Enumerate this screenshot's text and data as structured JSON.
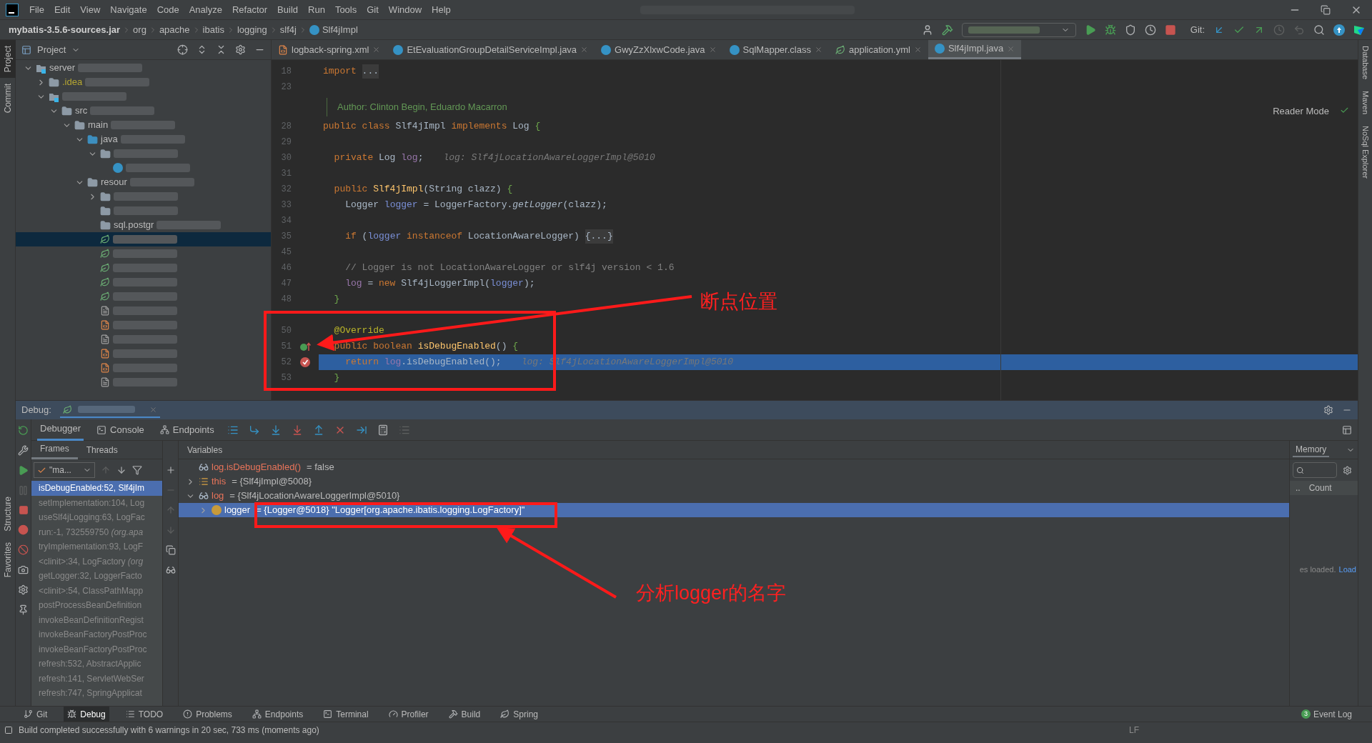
{
  "menu": [
    "File",
    "Edit",
    "View",
    "Navigate",
    "Code",
    "Analyze",
    "Refactor",
    "Build",
    "Run",
    "Tools",
    "Git",
    "Window",
    "Help"
  ],
  "breadcrumbs": [
    {
      "label": "mybatis-3.5.6-sources.jar",
      "kind": "root"
    },
    {
      "label": "org",
      "kind": "package"
    },
    {
      "label": "apache",
      "kind": "package"
    },
    {
      "label": "ibatis",
      "kind": "package"
    },
    {
      "label": "logging",
      "kind": "package"
    },
    {
      "label": "slf4j",
      "kind": "package"
    },
    {
      "label": "Slf4jImpl",
      "kind": "class"
    }
  ],
  "toolbar": {
    "git_label": "Git:"
  },
  "left_stripe": [
    {
      "label": "Project",
      "selected": true
    },
    {
      "label": "Commit",
      "selected": false
    },
    {
      "label": "Structure",
      "selected": false
    },
    {
      "label": "Favorites",
      "selected": false
    }
  ],
  "right_stripe": [
    {
      "label": "Database"
    },
    {
      "label": "Maven"
    },
    {
      "label": "NoSql Explorer"
    }
  ],
  "project": {
    "title": "Project",
    "tree": [
      {
        "label": "server",
        "kind": "module",
        "expanded": true,
        "selected": false,
        "children": [
          {
            "label": ".idea",
            "kind": "folder",
            "expanded": false,
            "selected": false
          },
          {
            "kind": "module",
            "expanded": true,
            "selected": false,
            "children": [
              {
                "label": "src",
                "kind": "folder",
                "expanded": true,
                "selected": false,
                "children": [
                  {
                    "label": "main",
                    "kind": "folder",
                    "expanded": true,
                    "selected": false,
                    "children": [
                      {
                        "label": "java",
                        "kind": "source",
                        "expanded": true,
                        "selected": false,
                        "children": [
                          {
                            "kind": "package",
                            "expanded": true,
                            "selected": false,
                            "children": [
                              {
                                "kind": "class",
                                "selected": false
                              }
                            ]
                          }
                        ]
                      },
                      {
                        "label": "resour",
                        "kind": "resources",
                        "expanded": true,
                        "selected": false,
                        "children": [
                          {
                            "kind": "folder",
                            "expanded": false,
                            "selected": false
                          },
                          {
                            "kind": "folder",
                            "selected": false
                          },
                          {
                            "label": "sql.postgr",
                            "kind": "folder",
                            "selected": false
                          },
                          {
                            "kind": "spring",
                            "selected": true
                          },
                          {
                            "kind": "spring",
                            "selected": false
                          },
                          {
                            "kind": "spring",
                            "selected": false
                          },
                          {
                            "kind": "spring",
                            "selected": false
                          },
                          {
                            "kind": "spring",
                            "selected": false
                          },
                          {
                            "kind": "text",
                            "selected": false
                          },
                          {
                            "kind": "xml",
                            "selected": false
                          },
                          {
                            "kind": "text",
                            "selected": false
                          },
                          {
                            "kind": "xml",
                            "selected": false
                          },
                          {
                            "kind": "xml",
                            "selected": false
                          },
                          {
                            "kind": "text",
                            "selected": false
                          }
                        ]
                      }
                    ]
                  }
                ]
              }
            ]
          }
        ]
      }
    ]
  },
  "editor": {
    "tabs": [
      {
        "label": "logback-spring.xml",
        "kind": "xml",
        "selected": false
      },
      {
        "label": "EtEvaluationGroupDetailServiceImpl.java",
        "kind": "class",
        "selected": false
      },
      {
        "label": "GwyZzXlxwCode.java",
        "kind": "class",
        "selected": false
      },
      {
        "label": "SqlMapper.class",
        "kind": "class",
        "selected": false
      },
      {
        "label": "application.yml",
        "kind": "spring",
        "selected": false
      },
      {
        "label": "Slf4jImpl.java",
        "kind": "class",
        "selected": true
      }
    ],
    "reader_mode": "Reader Mode",
    "lines": [
      {
        "number": "18",
        "current": false,
        "tokens": [
          {
            "kind": "keyword",
            "text": "import "
          },
          {
            "kind": "fold",
            "text": "..."
          }
        ]
      },
      {
        "number": "23",
        "current": false
      },
      {
        "kind": "doc",
        "text": "Author: Clinton Begin, Eduardo Macarron",
        "current": false
      },
      {
        "number": "28",
        "current": false,
        "tokens": [
          {
            "kind": "keyword",
            "text": "public class "
          },
          {
            "kind": "plain",
            "text": "Slf4jImpl "
          },
          {
            "kind": "keyword",
            "text": "implements "
          },
          {
            "kind": "plain",
            "text": "Log "
          },
          {
            "kind": "brace",
            "text": "{"
          }
        ]
      },
      {
        "number": "29",
        "current": false
      },
      {
        "number": "30",
        "current": false,
        "tokens": [
          {
            "kind": "keyword",
            "text": "  private "
          },
          {
            "kind": "plain",
            "text": "Log "
          },
          {
            "kind": "field",
            "text": "log"
          },
          {
            "kind": "plain",
            "text": ";"
          },
          {
            "kind": "hint",
            "text": "log: Slf4jLocationAwareLoggerImpl@5010"
          }
        ]
      },
      {
        "number": "31",
        "current": false
      },
      {
        "number": "32",
        "current": false,
        "tokens": [
          {
            "kind": "keyword",
            "text": "  public "
          },
          {
            "kind": "method",
            "text": "Slf4jImpl"
          },
          {
            "kind": "plain",
            "text": "(String clazz) "
          },
          {
            "kind": "brace",
            "text": "{"
          }
        ]
      },
      {
        "number": "33",
        "current": false,
        "tokens": [
          {
            "kind": "plain",
            "text": "    Logger "
          },
          {
            "kind": "var",
            "text": "logger"
          },
          {
            "kind": "plain",
            "text": " = LoggerFactory."
          },
          {
            "kind": "static",
            "text": "getLogger"
          },
          {
            "kind": "plain",
            "text": "(clazz);"
          }
        ]
      },
      {
        "number": "34",
        "current": false
      },
      {
        "number": "35",
        "current": false,
        "tokens": [
          {
            "kind": "keyword",
            "text": "    if "
          },
          {
            "kind": "plain",
            "text": "("
          },
          {
            "kind": "var",
            "text": "logger"
          },
          {
            "kind": "keyword",
            "text": " instanceof "
          },
          {
            "kind": "plain",
            "text": "LocationAwareLogger) "
          },
          {
            "kind": "fold",
            "text": "{...}"
          }
        ]
      },
      {
        "number": "45",
        "current": false
      },
      {
        "number": "46",
        "current": false,
        "tokens": [
          {
            "kind": "comment",
            "text": "    // Logger is not LocationAwareLogger or slf4j version < 1.6"
          }
        ]
      },
      {
        "number": "47",
        "current": false,
        "tokens": [
          {
            "kind": "field",
            "text": "    log"
          },
          {
            "kind": "plain",
            "text": " = "
          },
          {
            "kind": "keyword",
            "text": "new "
          },
          {
            "kind": "plain",
            "text": "Slf4jLoggerImpl("
          },
          {
            "kind": "var",
            "text": "logger"
          },
          {
            "kind": "plain",
            "text": ");"
          }
        ]
      },
      {
        "number": "48",
        "current": false,
        "tokens": [
          {
            "kind": "brace",
            "text": "  }"
          }
        ]
      },
      {
        "current": false
      },
      {
        "number": "50",
        "current": false,
        "tokens": [
          {
            "kind": "annotation",
            "text": "  @Override"
          }
        ]
      },
      {
        "number": "51",
        "current": false,
        "gutter": {
          "kind": "override"
        },
        "tokens": [
          {
            "kind": "keyword",
            "text": "  public boolean "
          },
          {
            "kind": "method",
            "text": "isDebugEnabled"
          },
          {
            "kind": "plain",
            "text": "() "
          },
          {
            "kind": "brace",
            "text": "{"
          }
        ]
      },
      {
        "number": "52",
        "current": true,
        "gutter": {
          "kind": "breakpoint"
        },
        "tokens": [
          {
            "kind": "keyword",
            "text": "    return "
          },
          {
            "kind": "field",
            "text": "log"
          },
          {
            "kind": "plain",
            "text": ".isDebugEnabled();"
          },
          {
            "kind": "hint",
            "text": "log: Slf4jLocationAwareLoggerImpl@5010"
          }
        ]
      },
      {
        "number": "53",
        "current": false,
        "tokens": [
          {
            "kind": "brace",
            "text": "  }"
          }
        ]
      }
    ]
  },
  "debug": {
    "title": "Debug:",
    "tabs": [
      {
        "label": "Debugger",
        "selected": true
      },
      {
        "label": "Console",
        "kind": "console",
        "selected": false
      },
      {
        "label": "Endpoints",
        "kind": "endpoints",
        "selected": false
      }
    ],
    "frame_tabs": [
      {
        "label": "Frames",
        "selected": true
      },
      {
        "label": "Threads",
        "selected": false
      }
    ],
    "variables_title": "Variables",
    "thread": "\"ma...",
    "frames": [
      {
        "text": "isDebugEnabled:52, Slf4jIm",
        "selected": true
      },
      {
        "text": "setImplementation:104, Log",
        "selected": false
      },
      {
        "text": "useSlf4jLogging:63, LogFac",
        "selected": false
      },
      {
        "text": "run:-1, 732559750 *(org.apa*",
        "selected": false
      },
      {
        "text": "tryImplementation:93, LogF",
        "selected": false
      },
      {
        "text": "<clinit>:34, LogFactory *(org*",
        "selected": false
      },
      {
        "text": "getLogger:32, LoggerFacto",
        "selected": false
      },
      {
        "text": "<clinit>:54, ClassPathMapp",
        "selected": false
      },
      {
        "text": "postProcessBeanDefinition",
        "selected": false
      },
      {
        "text": "invokeBeanDefinitionRegist",
        "selected": false
      },
      {
        "text": "invokeBeanFactoryPostProc",
        "selected": false
      },
      {
        "text": "invokeBeanFactoryPostProc",
        "selected": false
      },
      {
        "text": "refresh:532, AbstractApplic",
        "selected": false
      },
      {
        "text": "refresh:141, ServletWebSer",
        "selected": false
      },
      {
        "text": "refresh:747, SpringApplicat",
        "selected": false
      }
    ],
    "variables": [
      {
        "kind": "watch",
        "name": "log.isDebugEnabled()",
        "value": "= false",
        "selected": false
      },
      {
        "kind": "object",
        "name": "this",
        "value": "= {Slf4jImpl@5008}",
        "expanded": false,
        "selected": false
      },
      {
        "kind": "watch",
        "name": "log",
        "value": "= {Slf4jLocationAwareLoggerImpl@5010}",
        "expanded": true,
        "selected": false,
        "children": [
          {
            "kind": "field",
            "name": "logger",
            "value": "= {Logger@5018} \"Logger[org.apache.ibatis.logging.LogFactory]\"",
            "expanded": false,
            "selected": true
          }
        ]
      }
    ],
    "memory": {
      "tab": "Memory",
      "columns": [
        "..",
        "Count"
      ],
      "message": "es loaded.",
      "link": "Load"
    }
  },
  "bottom_tools": [
    {
      "label": "Git",
      "kind": "git",
      "selected": false
    },
    {
      "label": "Debug",
      "kind": "bug",
      "selected": true
    },
    {
      "label": "TODO",
      "kind": "list",
      "selected": false
    },
    {
      "label": "Problems",
      "kind": "problems",
      "selected": false
    },
    {
      "label": "Endpoints",
      "kind": "endpoints",
      "selected": false
    },
    {
      "label": "Terminal",
      "kind": "terminal",
      "selected": false
    },
    {
      "label": "Profiler",
      "kind": "profiler",
      "selected": false
    },
    {
      "label": "Build",
      "kind": "hammer",
      "selected": false
    },
    {
      "label": "Spring",
      "kind": "leaf",
      "selected": false
    }
  ],
  "event_log": {
    "label": "Event Log",
    "count": "3"
  },
  "status": {
    "message": "Build completed successfully with 6 warnings in 20 sec, 733 ms (moments ago)",
    "line_separator": "LF"
  },
  "annotations": [
    {
      "text": "断点位置"
    },
    {
      "text": "分析logger的名字"
    }
  ]
}
